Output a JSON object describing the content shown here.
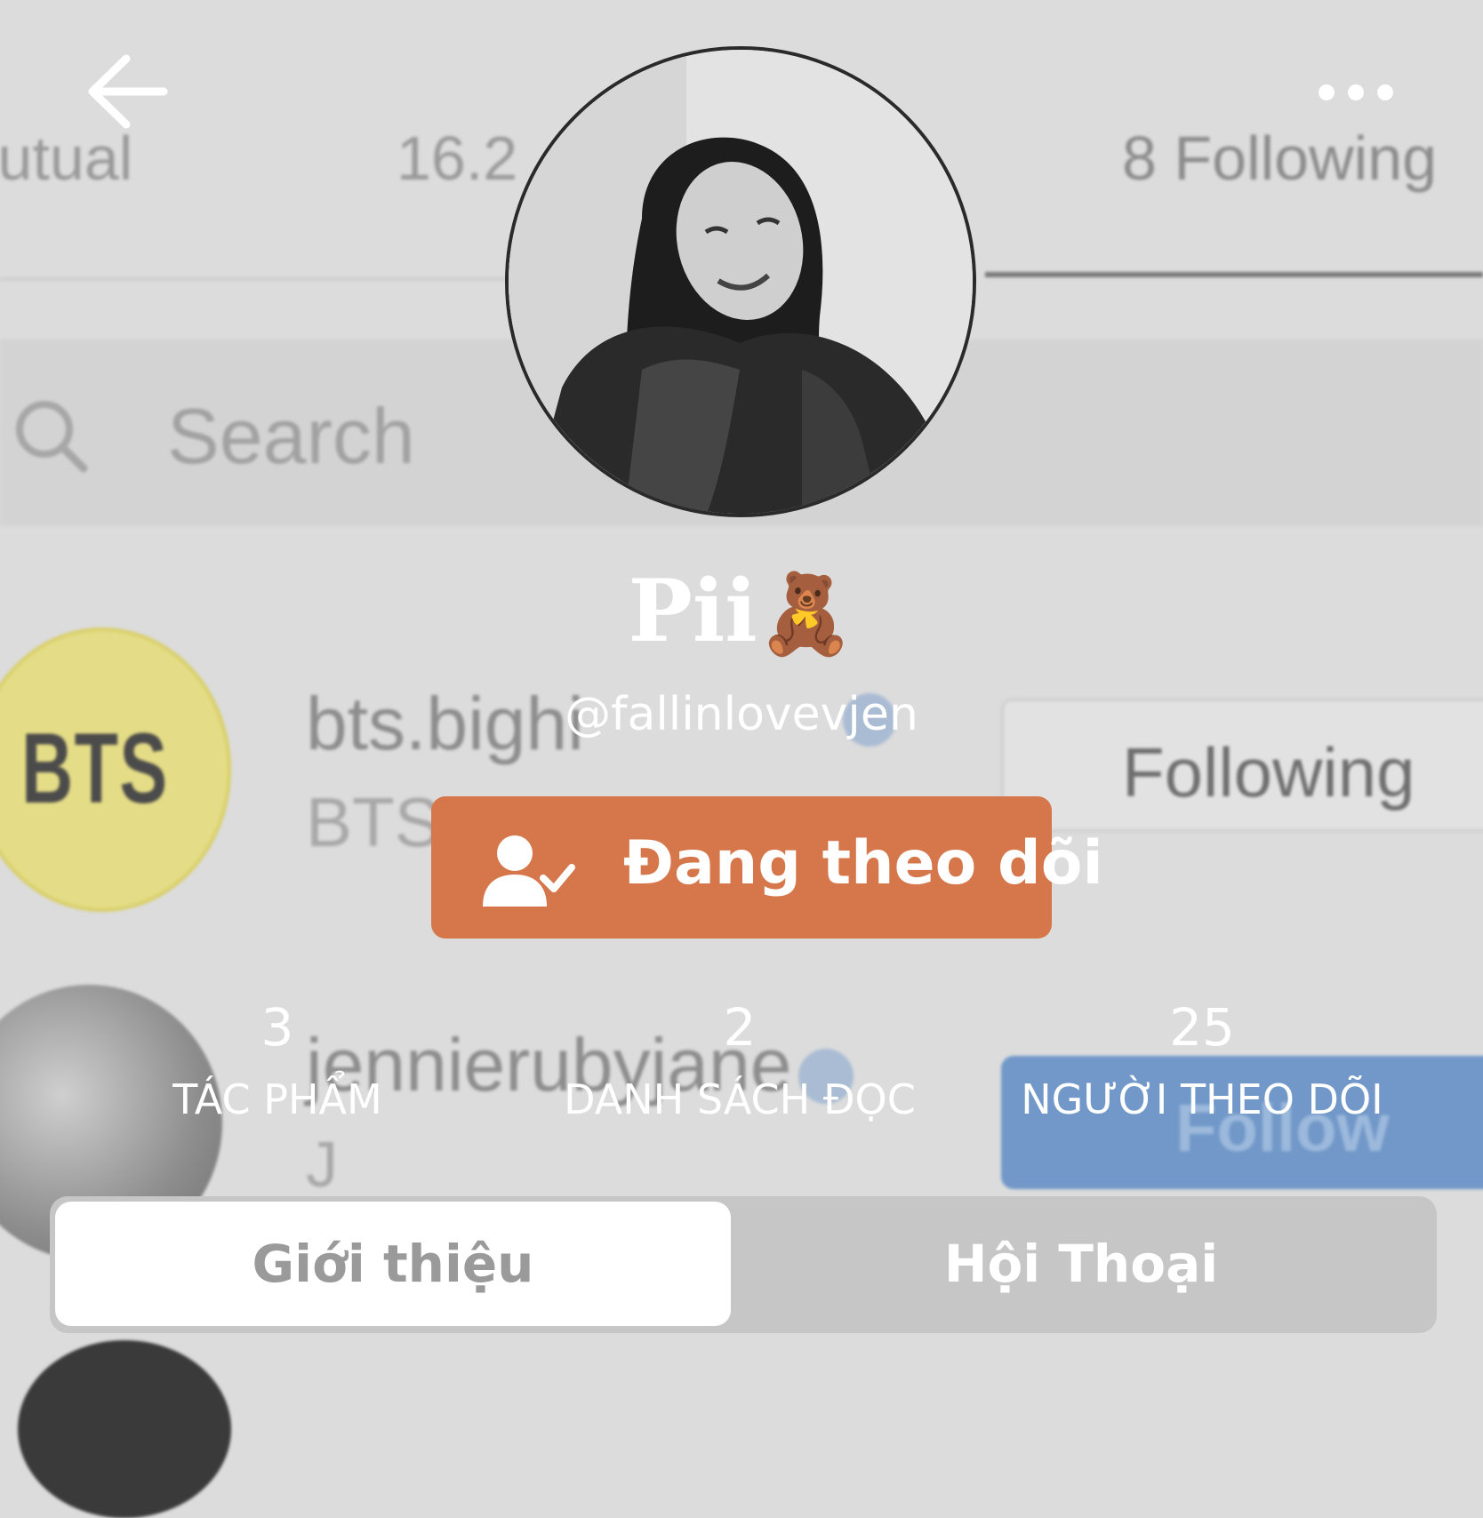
{
  "background": {
    "tabs": {
      "mutual": "lutual",
      "followers": "16.2",
      "following": "8 Following"
    },
    "search_placeholder": "Search",
    "rows": [
      {
        "avatar_text": "BTS",
        "name": "bts.bighi",
        "subtitle": "BTS"
      },
      {
        "name": "jennierubyjane",
        "subtitle": "J"
      }
    ],
    "following_label": "Following",
    "follow_label": "Follow",
    "colors": {
      "follow_button": "#7198c8",
      "bts_avatar": "#e4dc86"
    }
  },
  "profile": {
    "display_name": "Pii",
    "display_name_emoji": "🧸",
    "username": "@fallinlovevjen",
    "follow_button_label": "Đang theo dõi",
    "accent_color": "#d5774b"
  },
  "stats": [
    {
      "value": "3",
      "label": "TÁC PHẨM"
    },
    {
      "value": "2",
      "label": "DANH SÁCH ĐỌC"
    },
    {
      "value": "25",
      "label": "NGƯỜI THEO DÕI"
    }
  ],
  "tabs": {
    "about": "Giới thiệu",
    "chat": "Hội Thoại",
    "active": "about"
  },
  "icons": {
    "back": "back-arrow-icon",
    "more": "more-dots-icon",
    "follow_state": "user-check-icon",
    "search": "search-icon",
    "verified": "verified-badge-icon"
  }
}
